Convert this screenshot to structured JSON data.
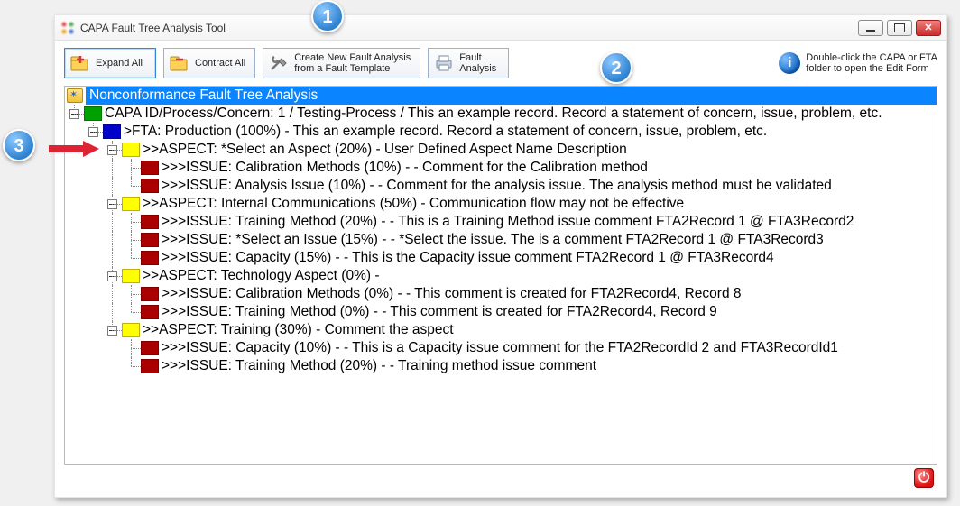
{
  "window": {
    "title": "CAPA Fault Tree Analysis Tool"
  },
  "callouts": {
    "c1": "1",
    "c2": "2",
    "c3": "3"
  },
  "toolbar": {
    "expand_all": "Expand All",
    "contract_all": "Contract All",
    "create_l1": "Create New Fault Analysis",
    "create_l2": "from a Fault Template",
    "fault_l1": "Fault",
    "fault_l2": "Analysis"
  },
  "info": {
    "l1": "Double-click the CAPA or FTA",
    "l2": "folder to open the Edit Form"
  },
  "tree": {
    "root": "Nonconformance Fault Tree Analysis",
    "capa": "CAPA ID/Process/Concern: 1 / Testing-Process / This an example record. Record a statement of concern, issue, problem, etc.",
    "fta": ">FTA: Production (100%) - This an example record. Record a statement of concern, issue, problem, etc.",
    "aspects": [
      {
        "label": ">>ASPECT: *Select an Aspect (20%) - User Defined Aspect Name Description",
        "issues": [
          ">>>ISSUE: Calibration Methods (10%) -  - Comment for the Calibration method",
          ">>>ISSUE: Analysis Issue (10%) -  - Comment for the analysis issue. The analysis method must be validated"
        ]
      },
      {
        "label": ">>ASPECT: Internal Communications (50%) - Communication flow may not be effective",
        "issues": [
          ">>>ISSUE: Training Method (20%) -  - This is a Training Method issue comment FTA2Record 1 @ FTA3Record2",
          ">>>ISSUE: *Select an Issue (15%) -  - *Select the issue. The is a comment FTA2Record 1 @ FTA3Record3",
          ">>>ISSUE: Capacity (15%) -  - This is the Capacity issue comment FTA2Record 1 @ FTA3Record4"
        ]
      },
      {
        "label": ">>ASPECT: Technology Aspect (0%) - ",
        "issues": [
          ">>>ISSUE: Calibration Methods (0%) -  - This comment is created for FTA2Record4, Record 8",
          ">>>ISSUE: Training Method (0%) -  - This comment is created for FTA2Record4, Record 9"
        ]
      },
      {
        "label": ">>ASPECT: Training (30%) - Comment the aspect",
        "issues": [
          ">>>ISSUE: Capacity (10%) -  - This is a Capacity issue comment for the FTA2RecordId 2 and FTA3RecordId1",
          ">>>ISSUE: Training Method (20%) -  - Training method issue comment"
        ]
      }
    ]
  }
}
